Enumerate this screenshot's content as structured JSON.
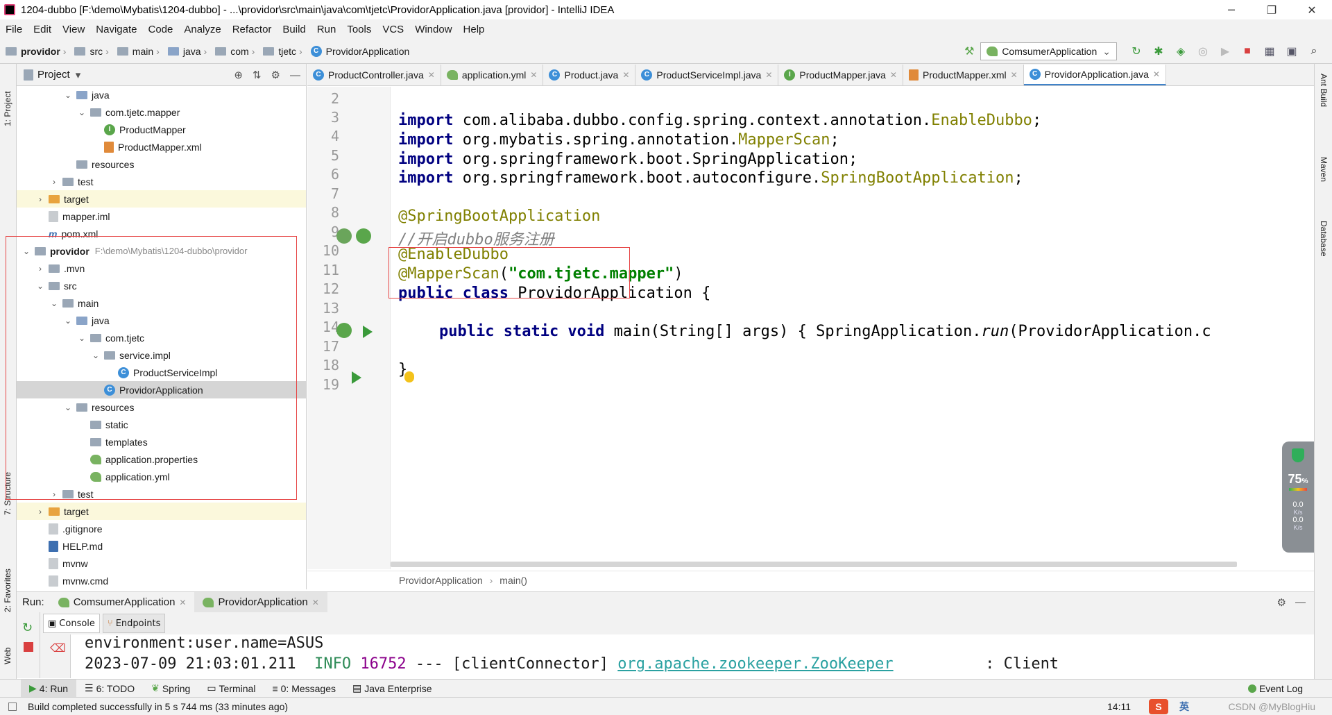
{
  "window": {
    "title": "1204-dubbo [F:\\demo\\Mybatis\\1204-dubbo] - ...\\providor\\src\\main\\java\\com\\tjetc\\ProvidorApplication.java [providor] - IntelliJ IDEA",
    "min": "─",
    "max": "❐",
    "close": "✕"
  },
  "menu": [
    "File",
    "Edit",
    "View",
    "Navigate",
    "Code",
    "Analyze",
    "Refactor",
    "Build",
    "Run",
    "Tools",
    "VCS",
    "Window",
    "Help"
  ],
  "nav": {
    "crumbs": [
      "providor",
      "src",
      "main",
      "java",
      "com",
      "tjetc",
      "ProvidorApplication"
    ],
    "run_config": "ComsumerApplication"
  },
  "left_strip": {
    "project": "1: Project",
    "structure": "7: Structure",
    "favorites": "2: Favorites",
    "web": "Web"
  },
  "right_strip": {
    "ant": "Ant Build",
    "maven": "Maven",
    "database": "Database"
  },
  "project_panel": {
    "title": "Project",
    "tree": [
      {
        "label": "java",
        "indent": 3,
        "arrow": "v",
        "icon": "folder"
      },
      {
        "label": "com.tjetc.mapper",
        "indent": 4,
        "arrow": "v",
        "icon": "pkg"
      },
      {
        "label": "ProductMapper",
        "indent": 5,
        "arrow": "",
        "icon": "interface"
      },
      {
        "label": "ProductMapper.xml",
        "indent": 5,
        "arrow": "",
        "icon": "xml"
      },
      {
        "label": "resources",
        "indent": 3,
        "arrow": "",
        "icon": "res"
      },
      {
        "label": "test",
        "indent": 2,
        "arrow": ">",
        "icon": "grey"
      },
      {
        "label": "target",
        "indent": 1,
        "arrow": ">",
        "icon": "orange",
        "hl": true
      },
      {
        "label": "mapper.iml",
        "indent": 1,
        "arrow": "",
        "icon": "file"
      },
      {
        "label": "pom.xml",
        "indent": 1,
        "arrow": "",
        "icon": "maven"
      },
      {
        "label": "providor",
        "indent": 0,
        "arrow": "v",
        "icon": "grey",
        "bold": true,
        "path": "F:\\demo\\Mybatis\\1204-dubbo\\providor"
      },
      {
        "label": ".mvn",
        "indent": 1,
        "arrow": ">",
        "icon": "grey"
      },
      {
        "label": "src",
        "indent": 1,
        "arrow": "v",
        "icon": "grey"
      },
      {
        "label": "main",
        "indent": 2,
        "arrow": "v",
        "icon": "grey"
      },
      {
        "label": "java",
        "indent": 3,
        "arrow": "v",
        "icon": "folder"
      },
      {
        "label": "com.tjetc",
        "indent": 4,
        "arrow": "v",
        "icon": "pkg"
      },
      {
        "label": "service.impl",
        "indent": 5,
        "arrow": "v",
        "icon": "pkg"
      },
      {
        "label": "ProductServiceImpl",
        "indent": 6,
        "arrow": "",
        "icon": "class"
      },
      {
        "label": "ProvidorApplication",
        "indent": 5,
        "arrow": "",
        "icon": "springclass",
        "selected": true
      },
      {
        "label": "resources",
        "indent": 3,
        "arrow": "v",
        "icon": "res"
      },
      {
        "label": "static",
        "indent": 4,
        "arrow": "",
        "icon": "grey"
      },
      {
        "label": "templates",
        "indent": 4,
        "arrow": "",
        "icon": "grey"
      },
      {
        "label": "application.properties",
        "indent": 4,
        "arrow": "",
        "icon": "leaf"
      },
      {
        "label": "application.yml",
        "indent": 4,
        "arrow": "",
        "icon": "leaf"
      },
      {
        "label": "test",
        "indent": 2,
        "arrow": ">",
        "icon": "grey"
      },
      {
        "label": "target",
        "indent": 1,
        "arrow": ">",
        "icon": "orange",
        "hl": true
      },
      {
        "label": ".gitignore",
        "indent": 1,
        "arrow": "",
        "icon": "file"
      },
      {
        "label": "HELP.md",
        "indent": 1,
        "arrow": "",
        "icon": "md"
      },
      {
        "label": "mvnw",
        "indent": 1,
        "arrow": "",
        "icon": "file"
      },
      {
        "label": "mvnw.cmd",
        "indent": 1,
        "arrow": "",
        "icon": "file"
      }
    ]
  },
  "tabs": [
    {
      "label": "ProductController.java",
      "icon": "class"
    },
    {
      "label": "application.yml",
      "icon": "leaf"
    },
    {
      "label": "Product.java",
      "icon": "class"
    },
    {
      "label": "ProductServiceImpl.java",
      "icon": "class"
    },
    {
      "label": "ProductMapper.java",
      "icon": "interface"
    },
    {
      "label": "ProductMapper.xml",
      "icon": "xml"
    },
    {
      "label": "ProvidorApplication.java",
      "icon": "springclass",
      "active": true
    }
  ],
  "editor": {
    "line_numbers": [
      "2",
      "3",
      "4",
      "5",
      "6",
      "7",
      "8",
      "9",
      "10",
      "11",
      "12",
      "13",
      "14",
      "17",
      "18",
      "19"
    ],
    "lines": {
      "l3_kw": "import",
      "l3_pkg": " com.alibaba.dubbo.config.spring.context.annotation.",
      "l3_cls": "EnableDubbo",
      "l3_end": ";",
      "l4_kw": "import",
      "l4_pkg": " org.mybatis.spring.annotation.",
      "l4_cls": "MapperScan",
      "l4_end": ";",
      "l5_kw": "import",
      "l5_pkg": " org.springframework.boot.SpringApplication;",
      "l6_kw": "import",
      "l6_pkg": " org.springframework.boot.autoconfigure.",
      "l6_cls": "SpringBootApplication",
      "l6_end": ";",
      "l8": "@SpringBootApplication",
      "l9": "//开启dubbo服务注册",
      "l10": "@EnableDubbo",
      "l11_ann": "@MapperScan",
      "l11_open": "(",
      "l11_str": "\"com.tjetc.mapper\"",
      "l11_close": ")",
      "l12_kw": "public class",
      "l12_rest": " ProvidorApplication {",
      "l14_kw": "public static void",
      "l14_a": " main(String[] args) ",
      "l14_b": "{ SpringApplication.",
      "l14_run": "run",
      "l14_c": "(ProvidorApplication.c",
      "l18": "}"
    },
    "breadcrumb": [
      "ProvidorApplication",
      "main()"
    ]
  },
  "gauge": {
    "percent": "75",
    "unit": "%",
    "up": "0.0",
    "up_unit": "K/s",
    "down": "0.0",
    "down_unit": "K/s"
  },
  "run_panel": {
    "label": "Run:",
    "tabs": [
      "ComsumerApplication",
      "ProvidorApplication"
    ],
    "subtabs": [
      "Console",
      "Endpoints"
    ],
    "console": {
      "line1": "environment:user.name=ASUS",
      "line2_ts": "2023-07-09 21:03:01.211",
      "line2_level": "INFO",
      "line2_pid": "16752",
      "line2_sep": "---",
      "line2_thread": "[clientConnector]",
      "line2_logger": "org.apache.zookeeper.ZooKeeper",
      "line2_msg": ": Client"
    }
  },
  "toolwindows": [
    "4: Run",
    "6: TODO",
    "Spring",
    "Terminal",
    "0: Messages",
    "Java Enterprise"
  ],
  "event_log": "Event Log",
  "status": {
    "message": "Build completed successfully in 5 s 744 ms (33 minutes ago)",
    "time": "14:11",
    "ime": "英",
    "watermark": "CSDN @MyBlogHiu"
  }
}
